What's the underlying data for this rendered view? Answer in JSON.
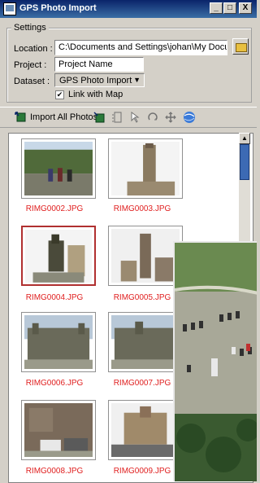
{
  "window": {
    "title": "GPS Photo Import",
    "min": "_",
    "max": "□",
    "close": "X"
  },
  "settings": {
    "legend": "Settings",
    "location_label": "Location :",
    "location_value": "C:\\Documents and Settings\\johan\\My Documents\\",
    "project_label": "Project :",
    "project_value": "Project Name",
    "dataset_label": "Dataset :",
    "dataset_value": "GPS Photo Import",
    "link_checked": "✔",
    "link_label": "Link with Map"
  },
  "toolbar": {
    "import_all_label": "Import All Photos"
  },
  "photos": [
    {
      "name": "RIMG0002.JPG"
    },
    {
      "name": "RIMG0003.JPG"
    },
    {
      "name": "RIMG0004.JPG"
    },
    {
      "name": "RIMG0005.JPG"
    },
    {
      "name": "RIMG0006.JPG"
    },
    {
      "name": "RIMG0007.JPG"
    },
    {
      "name": "RIMG0008.JPG"
    },
    {
      "name": "RIMG0009.JPG"
    }
  ],
  "colors": {
    "caption": "#e02020",
    "selection": "#b03030",
    "scroll_thumb": "#3c6ab4"
  }
}
